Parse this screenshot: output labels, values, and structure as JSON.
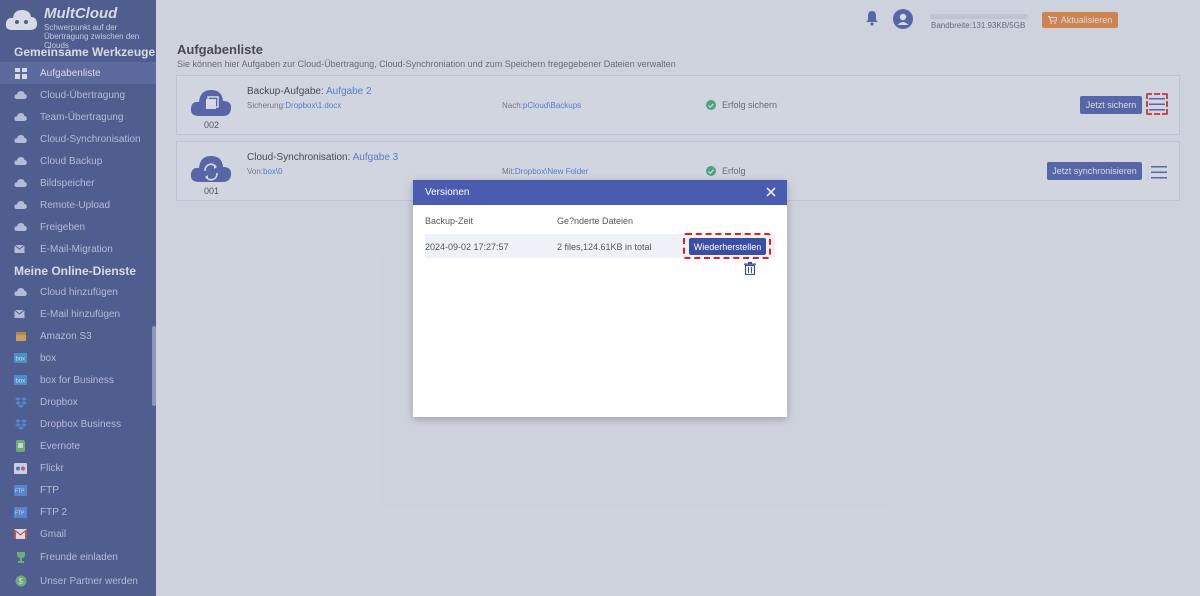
{
  "app": {
    "name": "MultCloud",
    "tagline": "Schwerpunkt auf der Übertragung zwischen den Clouds"
  },
  "sidebar": {
    "section1_title": "Gemeinsame Werkzeuge",
    "tools": [
      {
        "label": "Aufgabenliste",
        "icon": "grid-icon"
      },
      {
        "label": "Cloud-Übertragung",
        "icon": "cloud-transfer-icon"
      },
      {
        "label": "Team-Übertragung",
        "icon": "team-transfer-icon"
      },
      {
        "label": "Cloud-Synchronisation",
        "icon": "cloud-sync-icon"
      },
      {
        "label": "Cloud Backup",
        "icon": "cloud-backup-icon"
      },
      {
        "label": "Bildspeicher",
        "icon": "image-save-icon"
      },
      {
        "label": "Remote-Upload",
        "icon": "remote-upload-icon"
      },
      {
        "label": "Freigeben",
        "icon": "share-icon"
      },
      {
        "label": "E-Mail-Migration",
        "icon": "email-migration-icon"
      }
    ],
    "section2_title": "Meine Online-Dienste",
    "services": [
      {
        "label": "Cloud hinzufügen",
        "icon": "add-cloud-icon"
      },
      {
        "label": "E-Mail hinzufügen",
        "icon": "add-email-icon"
      },
      {
        "label": "Amazon S3",
        "icon": "amazon-s3-icon"
      },
      {
        "label": "box",
        "icon": "box-icon"
      },
      {
        "label": "box for Business",
        "icon": "box-business-icon"
      },
      {
        "label": "Dropbox",
        "icon": "dropbox-icon"
      },
      {
        "label": "Dropbox Business",
        "icon": "dropbox-business-icon"
      },
      {
        "label": "Evernote",
        "icon": "evernote-icon"
      },
      {
        "label": "Flickr",
        "icon": "flickr-icon"
      },
      {
        "label": "FTP",
        "icon": "ftp-icon"
      },
      {
        "label": "FTP 2",
        "icon": "ftp-icon"
      },
      {
        "label": "Gmail",
        "icon": "gmail-icon"
      }
    ],
    "footer": [
      {
        "label": "Freunde einladen",
        "icon": "trophy-icon"
      },
      {
        "label": "Unser Partner werden",
        "icon": "dollar-icon"
      }
    ]
  },
  "topbar": {
    "bandwidth": "Bandbreite:131.93KB/5GB",
    "upgrade_label": "Aktualisieren"
  },
  "page": {
    "title": "Aufgabenliste",
    "subtitle": "Sie können hier Aufgaben zur Cloud-Übertragung, Cloud-Synchroniation und zum Speichern fregegebener Dateien verwalten"
  },
  "tasks": [
    {
      "number": "002",
      "type_label": "Backup-Aufgabe:",
      "name": "Aufgabe 2",
      "source_label": "Sicherung:",
      "source": "Dropbox\\1.docx",
      "target_label": "Nach:",
      "target": "pCloud\\Backups",
      "status": "Erfolg sichern",
      "action_label": "Jetzt sichern"
    },
    {
      "number": "001",
      "type_label": "Cloud-Synchronisation:",
      "name": "Aufgabe 3",
      "source_label": "Von:",
      "source": "box\\0",
      "target_label": "Mit:",
      "target": "Dropbox\\New Folder",
      "status": "Erfolg",
      "action_label": "Jetzt synchronisieren"
    }
  ],
  "modal": {
    "title": "Versionen",
    "col_time": "Backup-Zeit",
    "col_files": "Ge?nderte Dateien",
    "rows": [
      {
        "time": "2024-09-02 17:27:57",
        "files": "2 files,124.61KB in total",
        "restore_label": "Wiederherstellen"
      }
    ]
  },
  "colors": {
    "sidebar": "#2f3f7e",
    "accent": "#3a4ea3",
    "modal_header": "#4a5bb0",
    "upgrade": "#f07b1d",
    "success": "#2ea86b",
    "highlight": "#e02020"
  }
}
